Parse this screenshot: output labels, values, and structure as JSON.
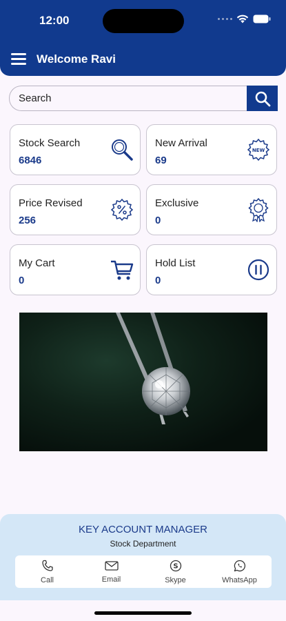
{
  "status_bar": {
    "time": "12:00"
  },
  "header": {
    "title": "Welcome Ravi"
  },
  "search": {
    "placeholder": "Search"
  },
  "cards": [
    {
      "label": "Stock Search",
      "value": "6846",
      "icon": "magnifier-icon"
    },
    {
      "label": "New Arrival",
      "value": "69",
      "icon": "new-badge-icon"
    },
    {
      "label": "Price Revised",
      "value": "256",
      "icon": "percent-icon"
    },
    {
      "label": "Exclusive",
      "value": "0",
      "icon": "award-icon"
    },
    {
      "label": "My Cart",
      "value": "0",
      "icon": "cart-icon"
    },
    {
      "label": "Hold List",
      "value": "0",
      "icon": "pause-icon"
    }
  ],
  "account_manager": {
    "title": "KEY ACCOUNT MANAGER",
    "department": "Stock Department",
    "contacts": [
      {
        "label": "Call",
        "icon": "phone-icon"
      },
      {
        "label": "Email",
        "icon": "email-icon"
      },
      {
        "label": "Skype",
        "icon": "skype-icon"
      },
      {
        "label": "WhatsApp",
        "icon": "whatsapp-icon"
      }
    ]
  },
  "colors": {
    "primary": "#113a8e",
    "value_text": "#1a3a8a",
    "panel": "#d4e7f7"
  }
}
